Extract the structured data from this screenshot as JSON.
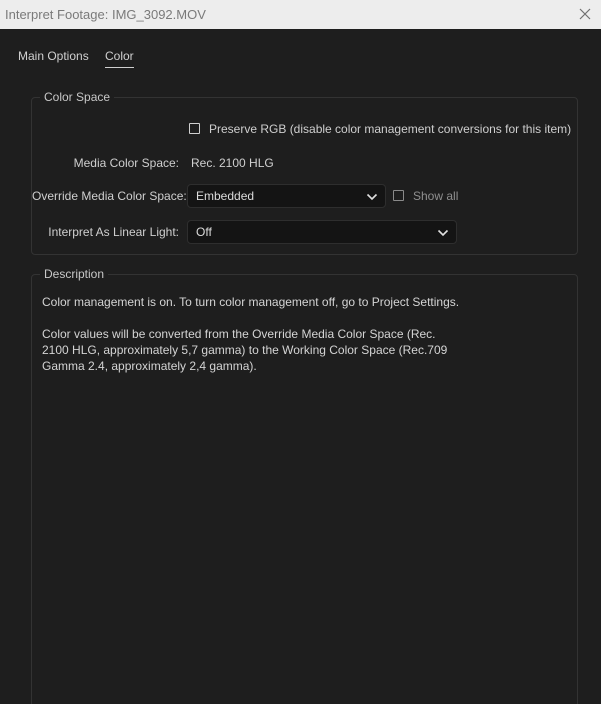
{
  "window": {
    "title": "Interpret Footage: IMG_3092.MOV"
  },
  "tabs": [
    {
      "label": "Main Options",
      "active": false
    },
    {
      "label": "Color",
      "active": true
    }
  ],
  "color_space": {
    "legend": "Color Space",
    "preserve_rgb": {
      "label": "Preserve RGB (disable color management conversions for this item)",
      "checked": false
    },
    "media_color_space": {
      "label": "Media Color Space:",
      "value": "Rec. 2100 HLG"
    },
    "override_media_color_space": {
      "label": "Override Media Color Space:",
      "value": "Embedded"
    },
    "show_all": {
      "label": "Show all",
      "checked": false
    },
    "interpret_linear_light": {
      "label": "Interpret As Linear Light:",
      "value": "Off"
    }
  },
  "description": {
    "legend": "Description",
    "paragraphs": [
      "Color management is on. To turn color management off, go to Project Settings.",
      "Color values will be converted from the Override Media Color Space (Rec. 2100 HLG, approximately 5,7 gamma) to the Working Color Space (Rec.709 Gamma 2.4, approximately 2,4 gamma)."
    ]
  },
  "icons": {
    "close": "close-icon",
    "dropdown": "chevron-down-icon"
  },
  "colors": {
    "background": "#1e1e1e",
    "titlebar": "#ededed",
    "field": "#141414",
    "text": "#d4d4d4"
  }
}
